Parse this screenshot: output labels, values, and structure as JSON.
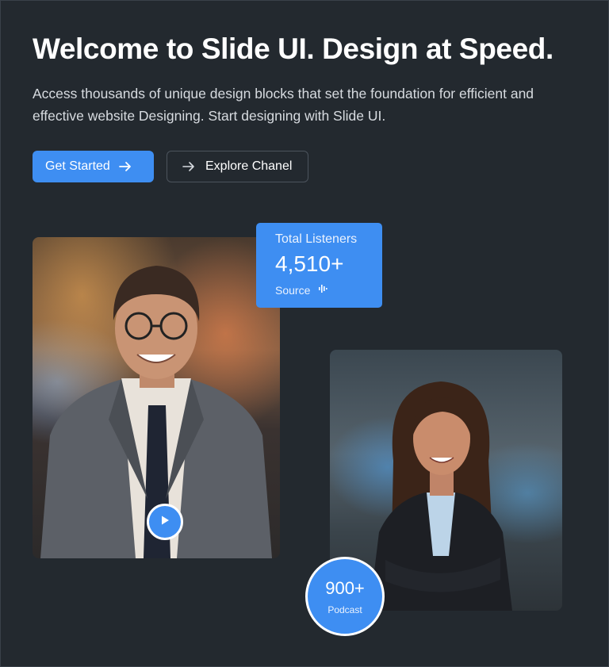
{
  "hero": {
    "title": "Welcome to Slide UI. Design at Speed.",
    "description": "Access thousands of unique design blocks that set the foundation for efficient and effective website Designing. Start designing with Slide UI.",
    "primary_button": "Get Started",
    "secondary_button": "Explore Chanel"
  },
  "stats_card": {
    "label": "Total Listeners",
    "value": "4,510+",
    "source": "Source",
    "icon": "audio-wave-icon"
  },
  "podcast_badge": {
    "value": "900+",
    "label": "Podcast"
  },
  "media": {
    "play_icon": "play-icon"
  },
  "colors": {
    "background": "#23292f",
    "accent": "#3e8ef2",
    "text": "#ffffff"
  }
}
